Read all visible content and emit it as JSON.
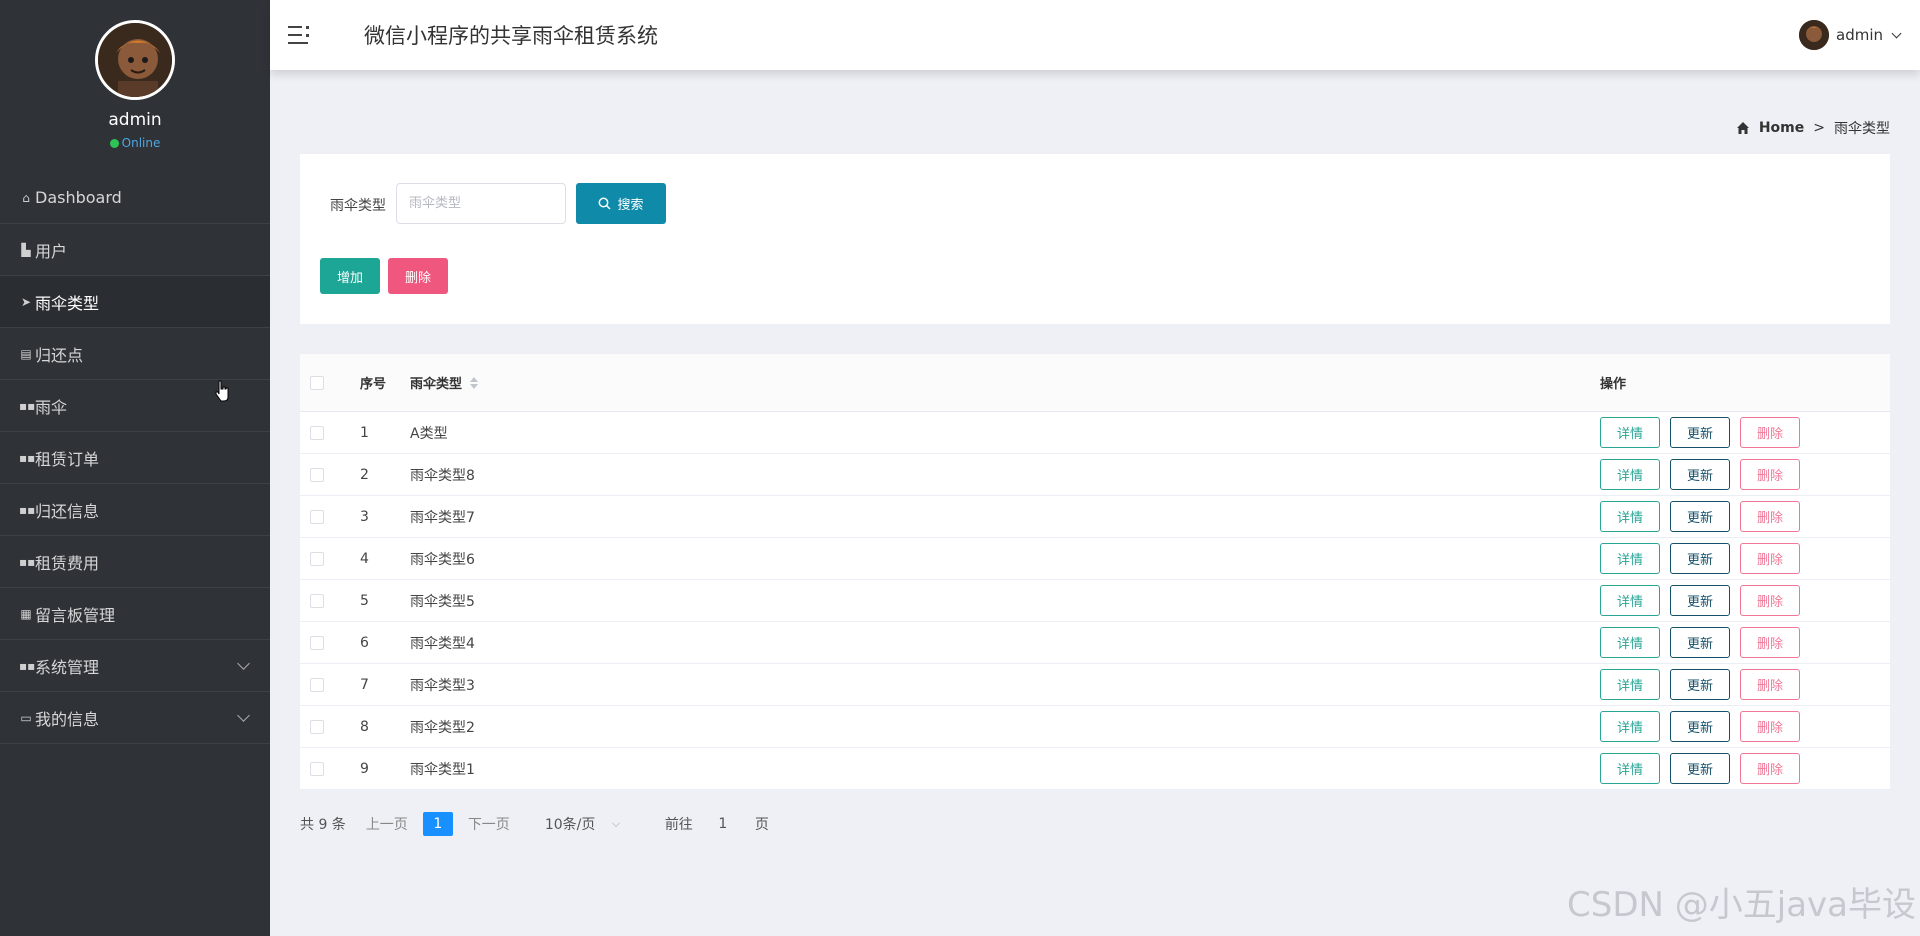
{
  "sidebar": {
    "profile": {
      "name": "admin",
      "status": "Online"
    },
    "items": [
      {
        "label": "Dashboard",
        "icon": "home-icon"
      },
      {
        "label": "用户",
        "icon": "folder-icon"
      },
      {
        "label": "雨伞类型",
        "icon": "send-icon"
      },
      {
        "label": "归还点",
        "icon": "clipboard-icon"
      },
      {
        "label": "雨伞",
        "icon": "grid-icon"
      },
      {
        "label": "租赁订单",
        "icon": "grid-icon"
      },
      {
        "label": "归还信息",
        "icon": "grid-icon"
      },
      {
        "label": "租赁费用",
        "icon": "grid-icon"
      },
      {
        "label": "留言板管理",
        "icon": "grid-icon"
      },
      {
        "label": "系统管理",
        "icon": "grid-icon"
      },
      {
        "label": "我的信息",
        "icon": "id-card-icon"
      }
    ]
  },
  "header": {
    "title": "微信小程序的共享雨伞租赁系统",
    "user": "admin"
  },
  "breadcrumb": {
    "home": "Home",
    "separator": ">",
    "current": "雨伞类型"
  },
  "search": {
    "label": "雨伞类型",
    "placeholder": "雨伞类型",
    "value": "",
    "button": "搜索"
  },
  "actions": {
    "add": "增加",
    "delete": "删除"
  },
  "table": {
    "headers": {
      "index": "序号",
      "type": "雨伞类型",
      "ops": "操作"
    },
    "op_labels": {
      "detail": "详情",
      "update": "更新",
      "delete": "删除"
    },
    "rows": [
      {
        "index": "1",
        "type": "A类型"
      },
      {
        "index": "2",
        "type": "雨伞类型8"
      },
      {
        "index": "3",
        "type": "雨伞类型7"
      },
      {
        "index": "4",
        "type": "雨伞类型6"
      },
      {
        "index": "5",
        "type": "雨伞类型5"
      },
      {
        "index": "6",
        "type": "雨伞类型4"
      },
      {
        "index": "7",
        "type": "雨伞类型3"
      },
      {
        "index": "8",
        "type": "雨伞类型2"
      },
      {
        "index": "9",
        "type": "雨伞类型1"
      }
    ]
  },
  "pagination": {
    "total": "共 9 条",
    "prev": "上一页",
    "current_page": "1",
    "next": "下一页",
    "page_size": "10条/页",
    "goto_label": "前往",
    "goto_value": "1",
    "goto_suffix": "页"
  },
  "watermark": "CSDN @小五java毕设",
  "colors": {
    "sidebar_bg": "#2f3338",
    "search_button": "#0f8aa8",
    "add_button": "#1da595",
    "delete_button": "#f0577e",
    "page_active": "#1890ff"
  }
}
